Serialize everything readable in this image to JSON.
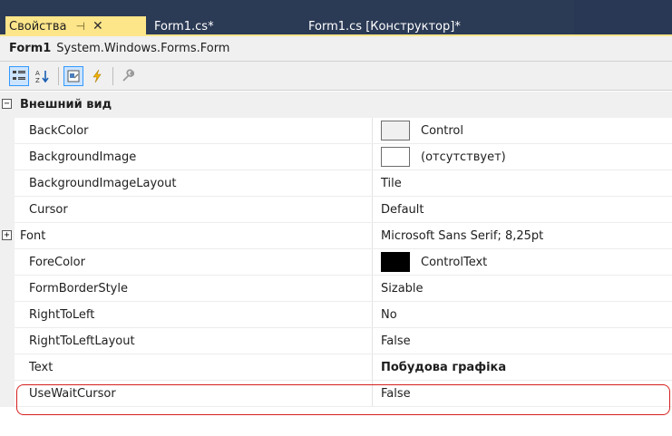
{
  "tabs": {
    "active": {
      "label": "Свойства",
      "pin_icon": "pin-icon",
      "close_icon": "close-icon"
    },
    "others": [
      {
        "label": "Form1.cs*"
      },
      {
        "label": "Form1.cs [Конструктор]*"
      }
    ]
  },
  "object_header": {
    "name": "Form1",
    "type": "System.Windows.Forms.Form"
  },
  "toolbar": {
    "buttons": [
      {
        "icon": "categorized-icon",
        "pressed": true
      },
      {
        "icon": "alphabetical-icon",
        "pressed": false
      },
      {
        "icon": "properties-icon",
        "pressed": true
      },
      {
        "icon": "events-icon",
        "pressed": false
      },
      {
        "icon": "property-pages-icon",
        "pressed": false
      }
    ]
  },
  "category": {
    "label": "Внешний вид",
    "expanded": true
  },
  "properties": [
    {
      "name": "BackColor",
      "value": "Control",
      "swatch": "#f0f0f0"
    },
    {
      "name": "BackgroundImage",
      "value": "(отсутствует)",
      "swatch": "#ffffff"
    },
    {
      "name": "BackgroundImageLayout",
      "value": "Tile"
    },
    {
      "name": "Cursor",
      "value": "Default"
    },
    {
      "name": "Font",
      "value": "Microsoft Sans Serif; 8,25pt",
      "expandable": true
    },
    {
      "name": "ForeColor",
      "value": "ControlText",
      "swatch": "#000000"
    },
    {
      "name": "FormBorderStyle",
      "value": "Sizable"
    },
    {
      "name": "RightToLeft",
      "value": "No"
    },
    {
      "name": "RightToLeftLayout",
      "value": "False"
    },
    {
      "name": "Text",
      "value": "Побудова графіка",
      "bold": true,
      "highlighted": true
    },
    {
      "name": "UseWaitCursor",
      "value": "False"
    }
  ],
  "colors": {
    "tab_active": "#fde58a",
    "tabstrip": "#2b3a55",
    "highlight_border": "#d62020"
  }
}
